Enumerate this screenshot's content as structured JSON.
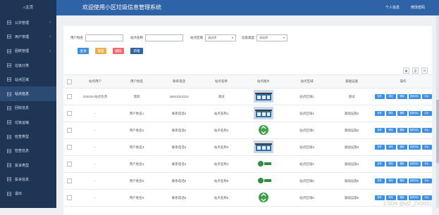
{
  "sidebar": {
    "home": "主页",
    "items": [
      {
        "label": "公共管理",
        "icon": "grid-icon",
        "active": false
      },
      {
        "label": "用户管理",
        "icon": "grid-icon",
        "active": false
      },
      {
        "label": "团统管理",
        "icon": "grid-icon",
        "active": false
      },
      {
        "label": "垃圾分类",
        "icon": "grid-icon",
        "active": false
      },
      {
        "label": "站点区域",
        "icon": "grid-icon",
        "active": false
      },
      {
        "label": "站点信息",
        "icon": "grid-icon",
        "active": true
      },
      {
        "label": "回收信息",
        "icon": "grid-icon",
        "active": false
      },
      {
        "label": "垃圾运输",
        "icon": "grid-icon",
        "active": false
      },
      {
        "label": "检查类型",
        "icon": "grid-icon",
        "active": false
      },
      {
        "label": "检查信息",
        "icon": "grid-icon",
        "active": false
      },
      {
        "label": "投诉类型",
        "icon": "grid-icon",
        "active": false
      },
      {
        "label": "投诉信息",
        "icon": "grid-icon",
        "active": false
      },
      {
        "label": "退出",
        "icon": "grid-icon",
        "active": false
      }
    ]
  },
  "header": {
    "title": "欢迎使用小区垃圾信息管理系统",
    "profile": "个人信息",
    "change_password": "修改密码"
  },
  "filters": {
    "user_name_label": "用户姓名",
    "site_name_label": "站点名称",
    "site_region_label": "站点区域",
    "region_placeholder": "请选择",
    "waste_type_label": "垃圾类型",
    "type_placeholder": "请选择"
  },
  "actions": {
    "search": "查询",
    "reset": "重置",
    "delete": "删除",
    "add": "新增",
    "colors": {
      "search": "#3e8fe0",
      "reset": "#f0ad4e",
      "delete": "#f06b6b",
      "add": "#2f63a8"
    }
  },
  "table": {
    "headers": [
      "站点用户",
      "用户姓名",
      "联系电话",
      "站点名称",
      "站点图片",
      "站点区域",
      "基础设施",
      "操作"
    ],
    "rows": [
      {
        "user": "234234-站点负责",
        "name": "李四",
        "phone": "15812312312",
        "site": "测试",
        "region": "站点区域1",
        "infra": "测试",
        "image": "building"
      },
      {
        "user": "-",
        "name": "用户姓名1",
        "phone": "联系电话1",
        "site": "站点名称1",
        "region": "站点区域1",
        "infra": "基础设施1",
        "image": "building"
      },
      {
        "user": "-",
        "name": "用户姓名2",
        "phone": "联系电话2",
        "site": "站点名称2",
        "region": "站点区域2",
        "infra": "基础设施2",
        "image": "recycle"
      },
      {
        "user": "-",
        "name": "用户姓名3",
        "phone": "联系电话3",
        "site": "站点名称3",
        "region": "站点区域3",
        "infra": "基础设施3",
        "image": "building"
      },
      {
        "user": "-",
        "name": "用户姓名4",
        "phone": "联系电话4",
        "site": "站点名称4",
        "region": "站点区域4",
        "infra": "基础设施4",
        "image": "logo"
      },
      {
        "user": "-",
        "name": "用户姓名5",
        "phone": "联系电话5",
        "site": "站点名称5",
        "region": "站点区域5",
        "infra": "基础设施5",
        "image": "logo"
      },
      {
        "user": "-",
        "name": "用户姓名6",
        "phone": "联系电话6",
        "site": "站点名称6",
        "region": "站点区域6",
        "infra": "基础设施6",
        "image": "recycle"
      }
    ],
    "ops": [
      "查看",
      "修改",
      "删除",
      "查看评论",
      "评价"
    ]
  },
  "watermark": "CSDN @MZ_ZXD001"
}
